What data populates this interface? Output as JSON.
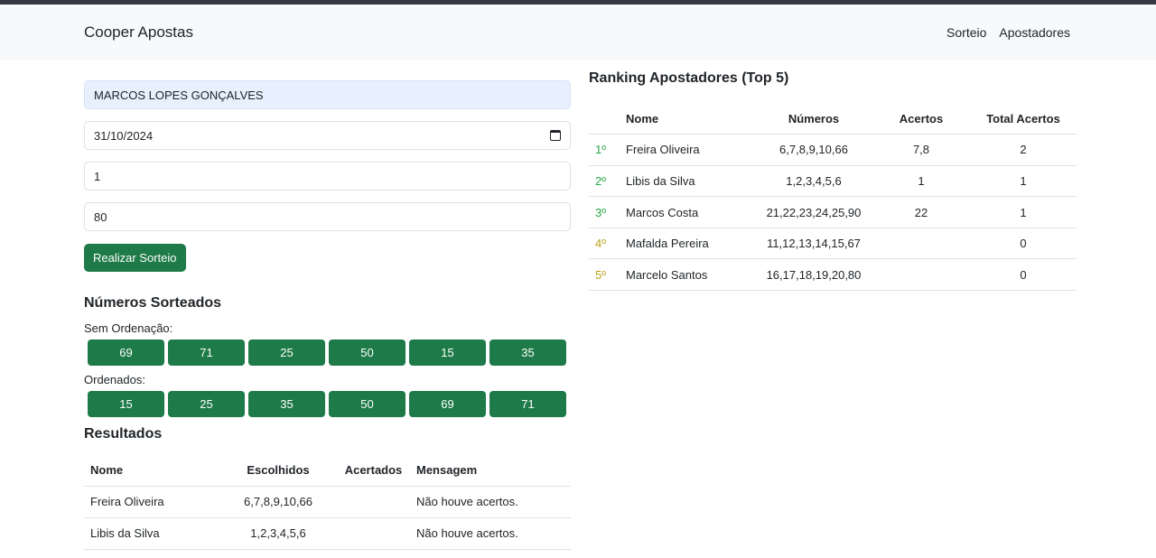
{
  "navbar": {
    "brand": "Cooper Apostas",
    "links": [
      "Sorteio",
      "Apostadores"
    ]
  },
  "form": {
    "name_value": "MARCOS LOPES GONÇALVES",
    "date_value": "31/10/2024",
    "field3_value": "1",
    "field4_value": "80",
    "submit_label": "Realizar Sorteio"
  },
  "drawn": {
    "title": "Números Sorteados",
    "unsorted_label": "Sem Ordenação:",
    "unsorted": [
      "69",
      "71",
      "25",
      "50",
      "15",
      "35"
    ],
    "sorted_label": "Ordenados:",
    "sorted": [
      "15",
      "25",
      "35",
      "50",
      "69",
      "71"
    ]
  },
  "results": {
    "title": "Resultados",
    "headers": [
      "Nome",
      "Escolhidos",
      "Acertados",
      "Mensagem"
    ],
    "rows": [
      {
        "nome": "Freira Oliveira",
        "escolhidos": "6,7,8,9,10,66",
        "acertados": "",
        "mensagem": "Não houve acertos."
      },
      {
        "nome": "Libis da Silva",
        "escolhidos": "1,2,3,4,5,6",
        "acertados": "",
        "mensagem": "Não houve acertos."
      }
    ]
  },
  "ranking": {
    "title": "Ranking Apostadores (Top 5)",
    "headers": [
      "Nome",
      "Números",
      "Acertos",
      "Total Acertos"
    ],
    "rows": [
      {
        "pos": "1º",
        "nome": "Freira Oliveira",
        "numeros": "6,7,8,9,10,66",
        "acertos": "7,8",
        "total": "2",
        "color": "#28a745"
      },
      {
        "pos": "2º",
        "nome": "Libis da Silva",
        "numeros": "1,2,3,4,5,6",
        "acertos": "1",
        "total": "1",
        "color": "#28a745"
      },
      {
        "pos": "3º",
        "nome": "Marcos Costa",
        "numeros": "21,22,23,24,25,90",
        "acertos": "22",
        "total": "1",
        "color": "#28a745"
      },
      {
        "pos": "4º",
        "nome": "Mafalda Pereira",
        "numeros": "11,12,13,14,15,67",
        "acertos": "",
        "total": "0",
        "color": "#b8a11a"
      },
      {
        "pos": "5º",
        "nome": "Marcelo Santos",
        "numeros": "16,17,18,19,20,80",
        "acertos": "",
        "total": "0",
        "color": "#b8a11a"
      }
    ]
  }
}
